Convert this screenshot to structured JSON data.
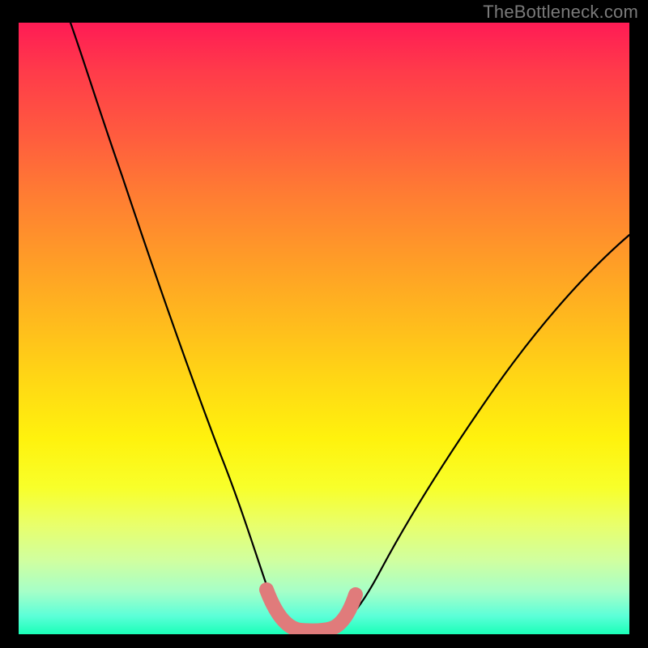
{
  "watermark": "TheBottleneck.com",
  "chart_data": {
    "type": "line",
    "title": "",
    "xlabel": "",
    "ylabel": "",
    "xlim": [
      0,
      100
    ],
    "ylim": [
      0,
      100
    ],
    "background_gradient": {
      "top": "#ff1b55",
      "middle": "#ffe010",
      "bottom": "#1affb8"
    },
    "series": [
      {
        "name": "bottleneck-curve",
        "color": "#000000",
        "x": [
          12,
          16,
          20,
          24,
          28,
          32,
          36,
          38.5,
          41,
          43,
          45,
          47,
          50,
          53,
          56,
          60,
          66,
          74,
          84,
          100
        ],
        "y": [
          100,
          92,
          82,
          71,
          59,
          45,
          28,
          15,
          4,
          1,
          0,
          0,
          0,
          2,
          6,
          12,
          22,
          34,
          46,
          62
        ]
      },
      {
        "name": "optimal-region-highlight",
        "color": "#e07b7b",
        "x": [
          41.5,
          43,
          45,
          48,
          51,
          53.5
        ],
        "y": [
          5,
          1.5,
          0.5,
          0.5,
          1.5,
          5
        ]
      }
    ],
    "optimal_x": 47,
    "optimal_y": 0
  }
}
